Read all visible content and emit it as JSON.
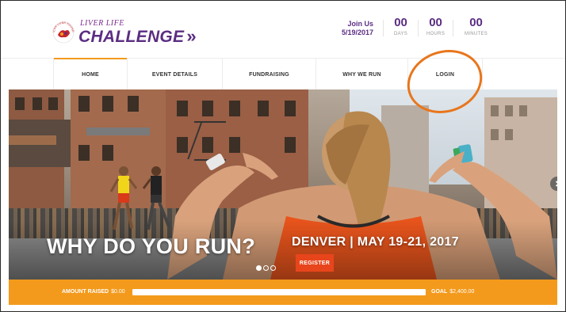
{
  "header": {
    "logo": {
      "badge_text": "AMERICAN LIVER FOUNDATION",
      "top": "LIVER LIFE",
      "main": "CHALLENGE"
    },
    "countdown": {
      "title": "Join Us",
      "date": "5/19/2017",
      "days": "00",
      "days_label": "DAYS",
      "hours": "00",
      "hours_label": "HOURS",
      "minutes": "00",
      "minutes_label": "MINUTES"
    }
  },
  "nav": {
    "items": [
      {
        "label": "HOME"
      },
      {
        "label": "EVENT DETAILS"
      },
      {
        "label": "FUNDRAISING"
      },
      {
        "label": "WHY WE RUN"
      },
      {
        "label": "LOGIN"
      }
    ]
  },
  "hero": {
    "title": "WHY DO YOU RUN?",
    "event": "DENVER | MAY 19-21, 2017",
    "register_label": "REGISTER",
    "slides_total": 3,
    "slide_active": 1
  },
  "fundraising": {
    "amount_label": "AMOUNT RAISED",
    "amount_value": "$0.00",
    "goal_label": "GOAL",
    "goal_value": "$2,400.00",
    "progress_fraction": 0
  },
  "colors": {
    "brand_purple": "#5b2d82",
    "accent_orange": "#f39a1c",
    "register_red": "#e8451c",
    "annotation_orange": "#e8761c"
  }
}
